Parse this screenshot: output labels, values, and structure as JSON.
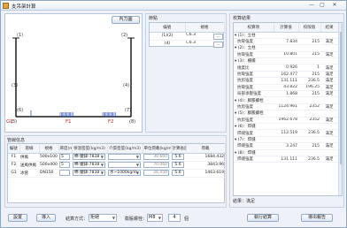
{
  "window": {
    "title": "支吊架計算",
    "min_glyph": "—",
    "max_glyph": "▢",
    "close_glyph": "✕"
  },
  "diagram": {
    "button_label": "內力圖",
    "node_labels": [
      "(1)",
      "(2)",
      "(3)",
      "(4)",
      "(5)",
      "(6)",
      "(7)",
      "(8)"
    ],
    "g1_label": "G1",
    "f1_label": "F1",
    "f2_label": "F2",
    "colors": {
      "frame": "#1a1a1a",
      "load": "#3355cc",
      "node_label": "#333333",
      "member_label": "#d42020"
    }
  },
  "joint": {
    "title": "節點",
    "headers": [
      "編號",
      "規格"
    ],
    "rows": [
      {
        "id": "(1)(2)",
        "spec": "∟6.3"
      },
      {
        "id": "(4)",
        "spec": "∟6.3"
      }
    ],
    "button_glyph": "..."
  },
  "pipe": {
    "title": "管線信息",
    "headers": [
      "編號",
      "管線",
      "規格",
      "厚度(mm)",
      "保溫密度(kg/m3)",
      "介質密度(kg/m3)",
      "單位荷載(kg/m)",
      "計算長度(m)",
      "荷載"
    ],
    "rows": [
      {
        "id": "F1",
        "name": "供風",
        "spec": "500x100",
        "thk": "5",
        "ins": "棉-鍍鋅-7838",
        "med": "",
        "unit": "30.660",
        "len": "5.6",
        "load": "1684.432"
      },
      {
        "id": "F2",
        "name": "送風供風",
        "spec": "500x400",
        "thk": "5",
        "ins": "棉-鍍鋅-7838",
        "med": "",
        "unit": "70.060",
        "len": "5.6",
        "load": "3843.96"
      },
      {
        "id": "G1",
        "name": "冰管",
        "spec": "DN150",
        "thk": "",
        "ins": "棉-鍍鋅-7838",
        "med": "水~1000kg/m",
        "unit": "26.450",
        "len": "5.6",
        "load": "1463.619"
      }
    ]
  },
  "results": {
    "title": "校算結果",
    "headers": [
      "校算項",
      "計算值",
      "校限值",
      "結果"
    ],
    "rows": [
      {
        "name": "▾ (1)：立柱",
        "group": true,
        "val": "",
        "lim": "",
        "res": ""
      },
      {
        "name": "抗彎強度",
        "group": false,
        "val": "7.834",
        "lim": "215",
        "res": "滿足"
      },
      {
        "name": "▾ (2)：立柱",
        "group": true,
        "val": "",
        "lim": "",
        "res": ""
      },
      {
        "name": "抗彎強度",
        "group": false,
        "val": "10.801",
        "lim": "215",
        "res": "滿足"
      },
      {
        "name": "▾ (3)：橫擔",
        "group": true,
        "val": "",
        "lim": "",
        "res": ""
      },
      {
        "name": "撓度比",
        "group": false,
        "val": "0.926",
        "lim": "1",
        "res": "滿足"
      },
      {
        "name": "抗彎強度",
        "group": false,
        "val": "162.477",
        "lim": "215",
        "res": "滿足"
      },
      {
        "name": "抗剪強度",
        "group": false,
        "val": "131.111",
        "lim": "236.5",
        "res": "滿足"
      },
      {
        "name": "抗彎強度",
        "group": false,
        "val": "43.822",
        "lim": "196.25",
        "res": "滿足"
      },
      {
        "name": "局部承壓強度",
        "group": false,
        "val": "1.868",
        "lim": "215",
        "res": "滿足"
      },
      {
        "name": "▾ (4)：膨脹螺栓",
        "group": true,
        "val": "",
        "lim": "",
        "res": ""
      },
      {
        "name": "抗剪強度",
        "group": false,
        "val": "1124.961",
        "lim": "2352",
        "res": "滿足"
      },
      {
        "name": "▾ (5)：膨脹螺栓",
        "group": true,
        "val": "",
        "lim": "",
        "res": ""
      },
      {
        "name": "抗剪強度",
        "group": false,
        "val": "1962.678",
        "lim": "2352",
        "res": "滿足"
      },
      {
        "name": "▾ (6)：焊縫",
        "group": true,
        "val": "",
        "lim": "",
        "res": ""
      },
      {
        "name": "焊縫強度",
        "group": false,
        "val": "112.519",
        "lim": "236.5",
        "res": "滿足"
      },
      {
        "name": "▾ (7)：焊縫",
        "group": true,
        "val": "",
        "lim": "",
        "res": ""
      },
      {
        "name": "焊縫強度",
        "group": false,
        "val": "3.247",
        "lim": "215",
        "res": "滿足"
      },
      {
        "name": "▾ (8)：焊縫",
        "group": true,
        "val": "",
        "lim": "",
        "res": ""
      },
      {
        "name": "焊縫強度",
        "group": false,
        "val": "131.111",
        "lim": "236.5",
        "res": "滿足"
      }
    ],
    "conclusion": "結果：滿足"
  },
  "footer": {
    "settings_label": "設置",
    "import_label": "導入",
    "method_label": "結算方式：",
    "method_value": "拒絕",
    "bolt_label": "膨脹螺栓：",
    "bolt_value": "M8",
    "bolt_count": "4",
    "bolt_unit": "個",
    "calc_label": "執行結算",
    "export_label": "導出報告"
  }
}
